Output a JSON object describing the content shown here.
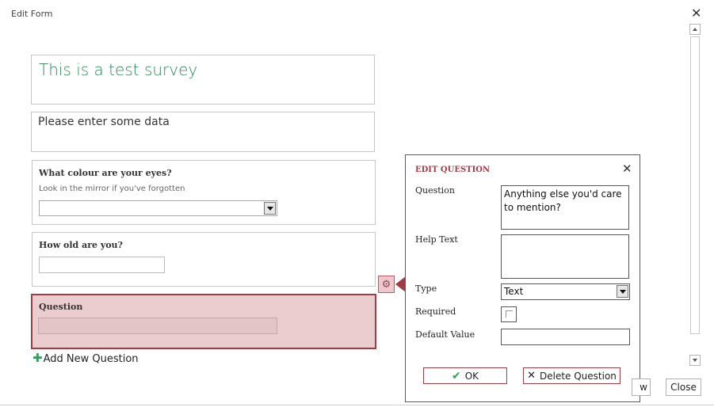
{
  "window": {
    "title": "Edit Form",
    "close_glyph": "✕"
  },
  "form": {
    "title": "This is a test survey",
    "description": "Please enter some data",
    "questions": [
      {
        "label": "What colour are your eyes?",
        "help": "Look in the mirror if you've forgotten",
        "type": "dropdown"
      },
      {
        "label": "How old are you?",
        "type": "text"
      },
      {
        "label": "Question",
        "type": "text",
        "selected": true
      }
    ],
    "add_question": "Add New Question"
  },
  "edit_panel": {
    "title": "EDIT QUESTION",
    "close_glyph": "✕",
    "question_label": "Question",
    "question_value": "Anything else you'd care to mention?",
    "help_label": "Help Text",
    "help_value": "",
    "type_label": "Type",
    "type_value": "Text",
    "required_label": "Required",
    "required_checked": false,
    "default_label": "Default Value",
    "default_value": "",
    "ok_label": "OK",
    "delete_label": "Delete Question"
  },
  "footer": {
    "partial_button": "w",
    "close_button": "Close"
  },
  "colors": {
    "accent": "#a03c46",
    "title_green": "#2c8a57",
    "selected_bg": "#ebcdd0"
  }
}
